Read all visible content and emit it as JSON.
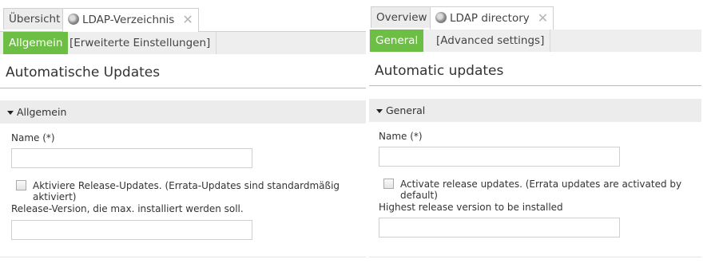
{
  "left": {
    "tabs": {
      "overview": "Übersicht",
      "module": "LDAP-Verzeichnis",
      "close": "✕"
    },
    "subtabs": {
      "general": "Allgemein",
      "advanced": "[Erweiterte Einstellungen]"
    },
    "page_title": "Automatische Updates",
    "section_title": "Allgemein",
    "name_label": "Name (*)",
    "checkbox_label": "Aktiviere Release-Updates. (Errata-Updates sind standardmäßig aktiviert)",
    "release_label": "Release-Version, die max. installiert werden soll."
  },
  "right": {
    "tabs": {
      "overview": "Overview",
      "module": "LDAP directory",
      "close": "✕"
    },
    "subtabs": {
      "general": "General",
      "advanced": "[Advanced settings]"
    },
    "page_title": "Automatic updates",
    "section_title": "General",
    "name_label": "Name (*)",
    "checkbox_label": "Activate release updates. (Errata updates are activated by default)",
    "release_label": "Highest release version to be installed"
  },
  "colors": {
    "accent": "#6cbf44"
  }
}
